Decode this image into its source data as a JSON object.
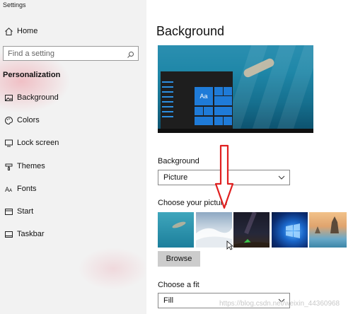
{
  "window": {
    "title": "Settings"
  },
  "sidebar": {
    "home": {
      "label": "Home",
      "icon": "home-icon"
    },
    "search": {
      "placeholder": "Find a setting",
      "icon": "search-icon"
    },
    "section": "Personalization",
    "items": [
      {
        "label": "Background",
        "icon": "image-icon"
      },
      {
        "label": "Colors",
        "icon": "palette-icon"
      },
      {
        "label": "Lock screen",
        "icon": "lock-screen-icon"
      },
      {
        "label": "Themes",
        "icon": "brush-icon"
      },
      {
        "label": "Fonts",
        "icon": "fonts-icon"
      },
      {
        "label": "Start",
        "icon": "start-icon"
      },
      {
        "label": "Taskbar",
        "icon": "taskbar-icon"
      }
    ]
  },
  "main": {
    "title": "Background",
    "preview": {
      "tile_text": "Aa"
    },
    "background_label": "Background",
    "background_value": "Picture",
    "choose_picture_label": "Choose your picture",
    "pictures": [
      "underwater",
      "snowy-hills",
      "night-sky-tent",
      "windows-logo",
      "beach-rocks"
    ],
    "browse_label": "Browse",
    "fit_label": "Choose a fit",
    "fit_value": "Fill"
  },
  "annotation": {
    "color": "#e02020"
  },
  "watermark": "https://blog.csdn.net/weixin_44360968"
}
